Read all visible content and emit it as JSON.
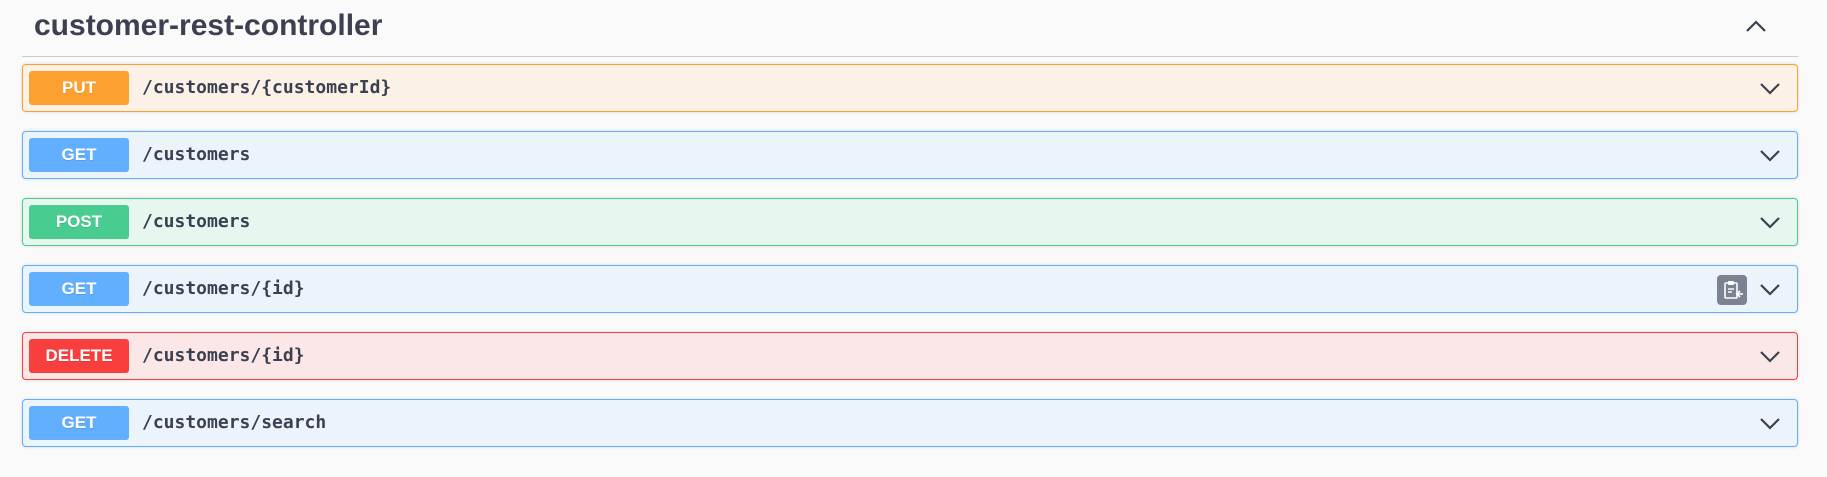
{
  "section": {
    "title": "customer-rest-controller",
    "toggle_icon": "chevron-up-icon"
  },
  "operations": [
    {
      "method": "PUT",
      "path": "/customers/{customerId}",
      "color": "#fca130",
      "background": "#fcf1e6"
    },
    {
      "method": "GET",
      "path": "/customers",
      "color": "#61affe",
      "background": "#ebf3fb"
    },
    {
      "method": "POST",
      "path": "/customers",
      "color": "#49cc90",
      "background": "#e7f6ef"
    },
    {
      "method": "GET",
      "path": "/customers/{id}",
      "color": "#61affe",
      "background": "#ebf3fb",
      "copy_icon": "clipboard-copy-icon"
    },
    {
      "method": "DELETE",
      "path": "/customers/{id}",
      "color": "#f93e3e",
      "background": "#fbe7e7"
    },
    {
      "method": "GET",
      "path": "/customers/search",
      "color": "#61affe",
      "background": "#ebf3fb"
    }
  ],
  "icons": {
    "expand": "chevron-down-icon",
    "collapse": "chevron-up-icon",
    "copy": "clipboard-copy-icon"
  }
}
